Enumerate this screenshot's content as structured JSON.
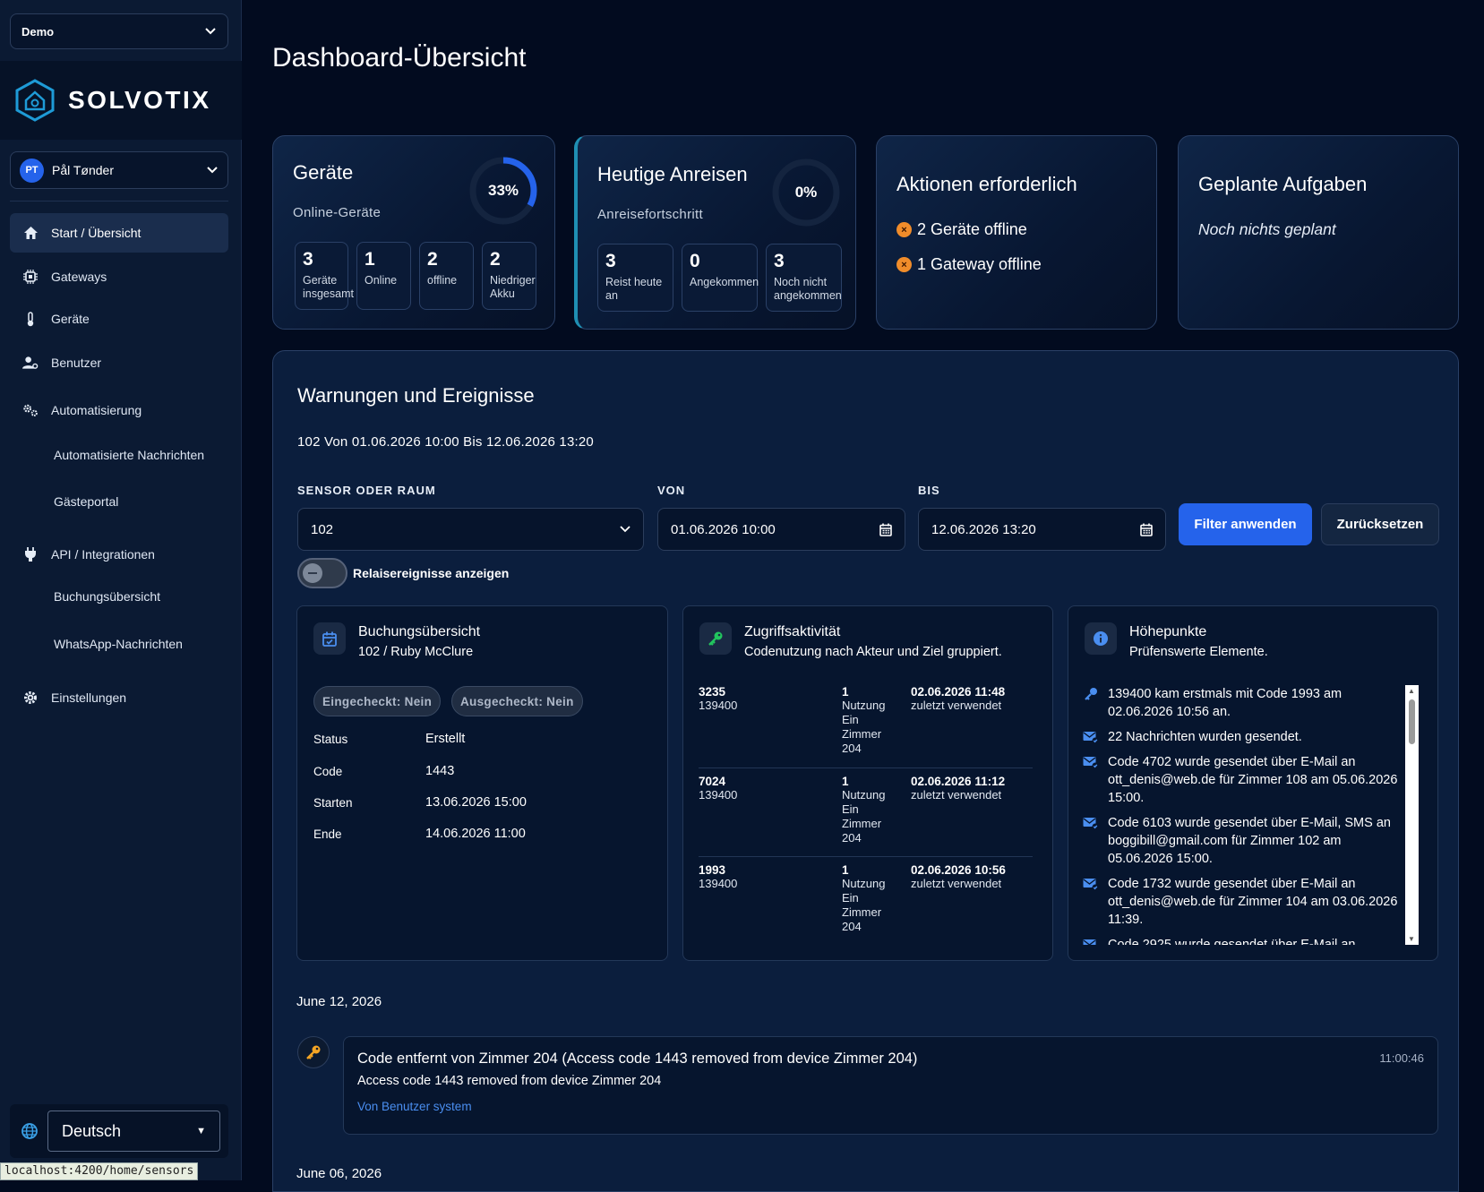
{
  "sidebar": {
    "tenant": "Demo",
    "logo_text": "SOLVOTIX",
    "user": {
      "initials": "PT",
      "name": "Pål Tønder"
    },
    "nav": {
      "start": "Start / Übersicht",
      "gateways": "Gateways",
      "devices": "Geräte",
      "users": "Benutzer",
      "automation": "Automatisierung",
      "automated_messages": "Automatisierte Nachrichten",
      "guest_portal": "Gästeportal",
      "api": "API / Integrationen",
      "booking_overview": "Buchungsübersicht",
      "whatsapp": "WhatsApp-Nachrichten",
      "settings": "Einstellungen"
    },
    "language": "Deutsch"
  },
  "status_url": "localhost:4200/home/sensors",
  "page_title": "Dashboard-Übersicht",
  "cards": {
    "devices": {
      "title": "Geräte",
      "subtitle": "Online-Geräte",
      "percent_label": "33%",
      "percent_value": 0.33,
      "stats": [
        {
          "num": "3",
          "label": "Geräte insgesamt"
        },
        {
          "num": "1",
          "label": "Online"
        },
        {
          "num": "2",
          "label": "offline"
        },
        {
          "num": "2",
          "label": "Niedriger Akku"
        }
      ]
    },
    "arrivals": {
      "title": "Heutige Anreisen",
      "subtitle": "Anreisefortschritt",
      "percent_label": "0%",
      "percent_value": 0,
      "stats": [
        {
          "num": "3",
          "label": "Reist heute an"
        },
        {
          "num": "0",
          "label": "Angekommen"
        },
        {
          "num": "3",
          "label": "Noch nicht angekommen"
        }
      ]
    },
    "actions": {
      "title": "Aktionen erforderlich",
      "items": [
        "2 Geräte offline",
        "1 Gateway offline"
      ]
    },
    "tasks": {
      "title": "Geplante Aufgaben",
      "empty": "Noch nichts geplant"
    }
  },
  "warnings": {
    "title": "Warnungen und Ereignisse",
    "range_text": "102 Von 01.06.2026 10:00 Bis 12.06.2026 13:20",
    "filter": {
      "sensor_label": "SENSOR ODER RAUM",
      "sensor_value": "102",
      "from_label": "VON",
      "from_value": "01.06.2026 10:00",
      "to_label": "BIS",
      "to_value": "12.06.2026 13:20",
      "apply": "Filter anwenden",
      "reset": "Zurücksetzen",
      "relay_toggle": "Relaisereignisse anzeigen",
      "relay_on": false
    },
    "booking": {
      "title": "Buchungsübersicht",
      "subtitle": "102 / Ruby McClure",
      "checked_in": "Eingecheckt: Nein",
      "checked_out": "Ausgecheckt: Nein",
      "rows": [
        {
          "k": "Status",
          "v": "Erstellt"
        },
        {
          "k": "Code",
          "v": "1443"
        },
        {
          "k": "Starten",
          "v": "13.06.2026 15:00"
        },
        {
          "k": "Ende",
          "v": "14.06.2026 11:00"
        }
      ]
    },
    "access": {
      "title": "Zugriffsaktivität",
      "subtitle": "Codenutzung nach Akteur und Ziel gruppiert.",
      "rows": [
        {
          "code": "3235",
          "actor": "139400",
          "count": "1",
          "usage": "Nutzung",
          "target": "Ein Zimmer 204",
          "time": "02.06.2026 11:48",
          "note": "zuletzt verwendet"
        },
        {
          "code": "7024",
          "actor": "139400",
          "count": "1",
          "usage": "Nutzung",
          "target": "Ein Zimmer 204",
          "time": "02.06.2026 11:12",
          "note": "zuletzt verwendet"
        },
        {
          "code": "1993",
          "actor": "139400",
          "count": "1",
          "usage": "Nutzung",
          "target": "Ein Zimmer 204",
          "time": "02.06.2026 10:56",
          "note": "zuletzt verwendet"
        }
      ]
    },
    "highlights": {
      "title": "Höhepunkte",
      "subtitle": "Prüfenswerte Elemente.",
      "items": [
        {
          "icon": "key-icon",
          "text": "139400 kam erstmals mit Code 1993 am 02.06.2026 10:56 an."
        },
        {
          "icon": "mail-sent-icon",
          "text": "22 Nachrichten wurden gesendet."
        },
        {
          "icon": "mail-sent-icon",
          "text": "Code 4702 wurde gesendet über E-Mail an ott_denis@web.de für Zimmer 108 am 05.06.2026 15:00."
        },
        {
          "icon": "mail-sent-icon",
          "text": "Code 6103 wurde gesendet über E-Mail, SMS an boggibill@gmail.com für Zimmer 102 am 05.06.2026 15:00."
        },
        {
          "icon": "mail-sent-icon",
          "text": "Code 1732 wurde gesendet über E-Mail an ott_denis@web.de für Zimmer 104 am 03.06.2026 11:39."
        },
        {
          "icon": "mail-sent-icon",
          "text": "Code 2925 wurde gesendet über E-Mail an"
        }
      ]
    },
    "timeline": [
      {
        "date": "June 12, 2026",
        "events": [
          {
            "title": "Code entfernt von Zimmer 204 (Access code 1443 removed from device Zimmer 204)",
            "detail": "Access code 1443 removed from device Zimmer 204",
            "by": "Von Benutzer system",
            "time": "11:00:46"
          }
        ]
      },
      {
        "date": "June 06, 2026"
      }
    ]
  },
  "colors": {
    "accent": "#2563eb",
    "ring_track": "#14243f",
    "warning": "#f08c2a",
    "key_green": "#22c55e",
    "key_orange": "#f5a524"
  }
}
